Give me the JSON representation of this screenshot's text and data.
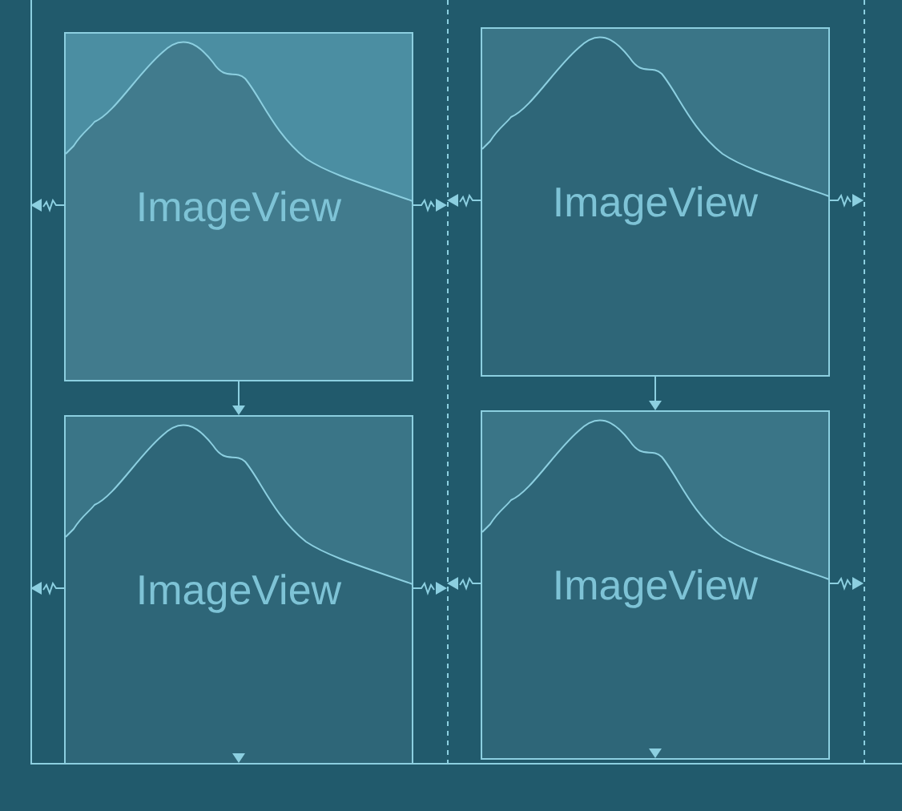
{
  "views": [
    {
      "label": "ImageView",
      "selected": true
    },
    {
      "label": "ImageView",
      "selected": false
    },
    {
      "label": "ImageView",
      "selected": false
    },
    {
      "label": "ImageView",
      "selected": false
    }
  ]
}
